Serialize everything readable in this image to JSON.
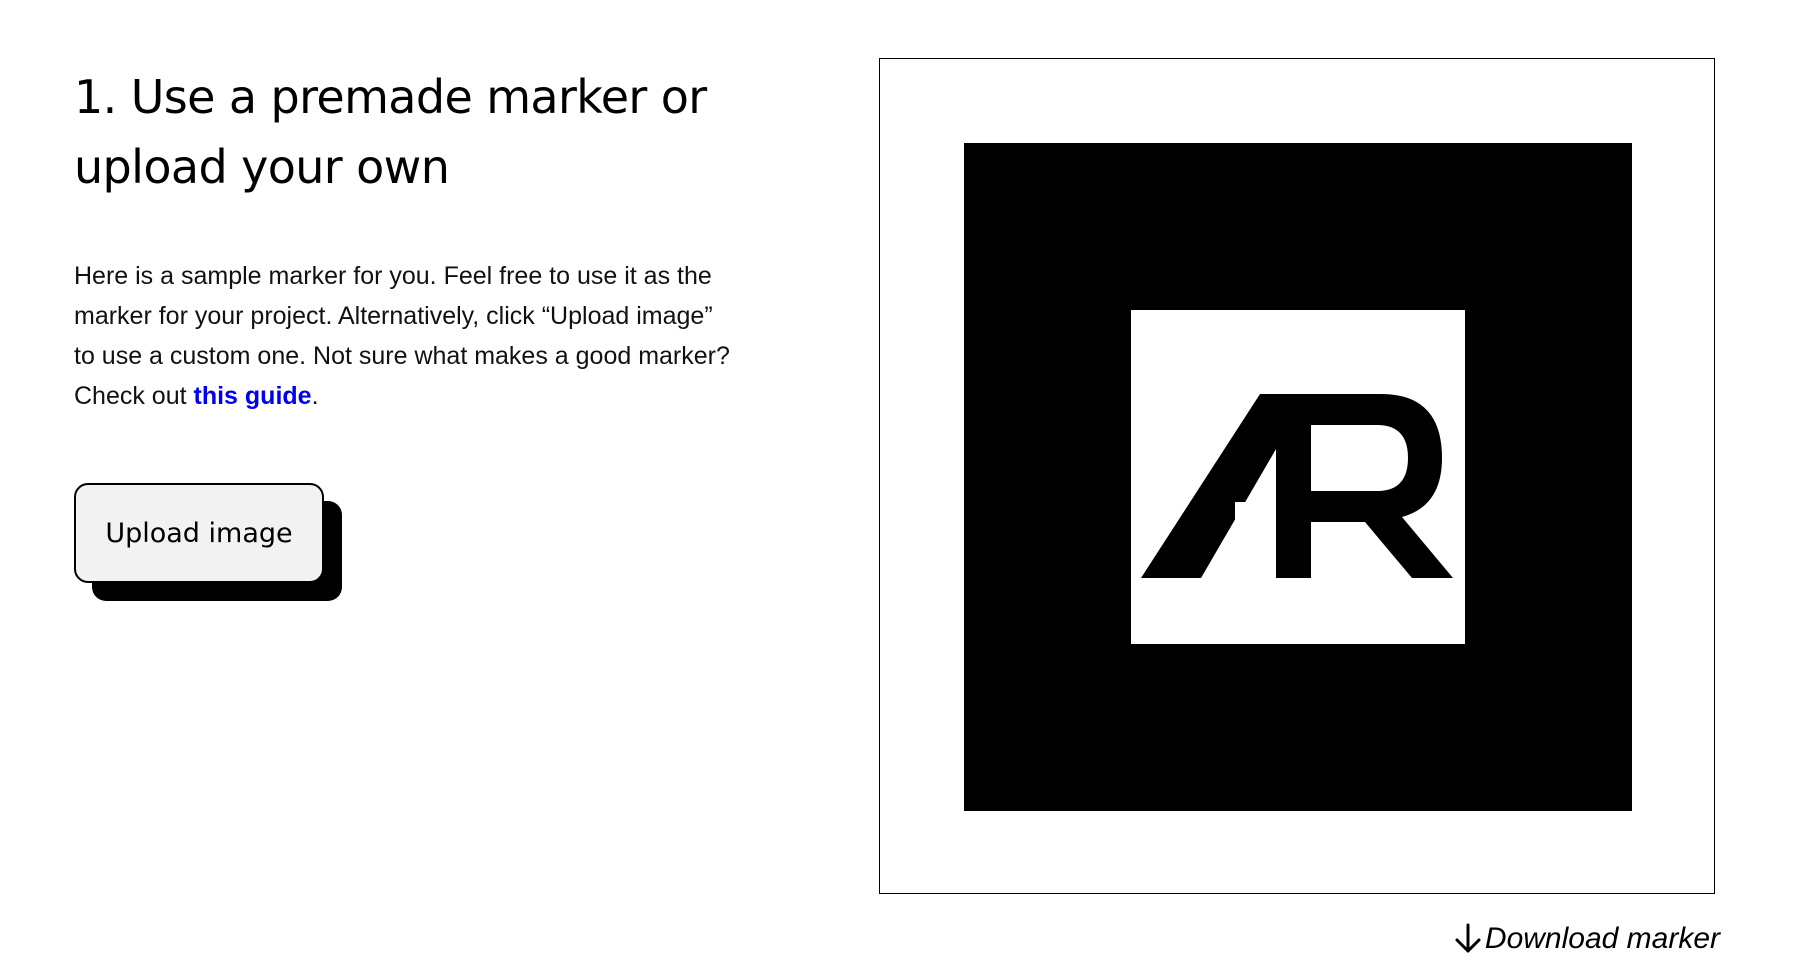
{
  "step": {
    "heading": "1. Use a premade marker or upload your own"
  },
  "description": {
    "line1": "Here is a sample marker for you. Feel free to use it as the",
    "line2": "marker for your project. Alternatively, click “Upload image”",
    "line3": "to use a custom one. Not sure what makes a good marker?",
    "line4_prefix": "Check out ",
    "link_text": "this guide",
    "line4_suffix": "."
  },
  "upload": {
    "button_label": "Upload image"
  },
  "marker": {
    "logo_text": "AR",
    "download_label": "Download marker",
    "download_icon": "arrow-down-icon"
  },
  "colors": {
    "link": "#0000ee",
    "button_bg": "#f2f2f2",
    "marker": "#000000"
  }
}
